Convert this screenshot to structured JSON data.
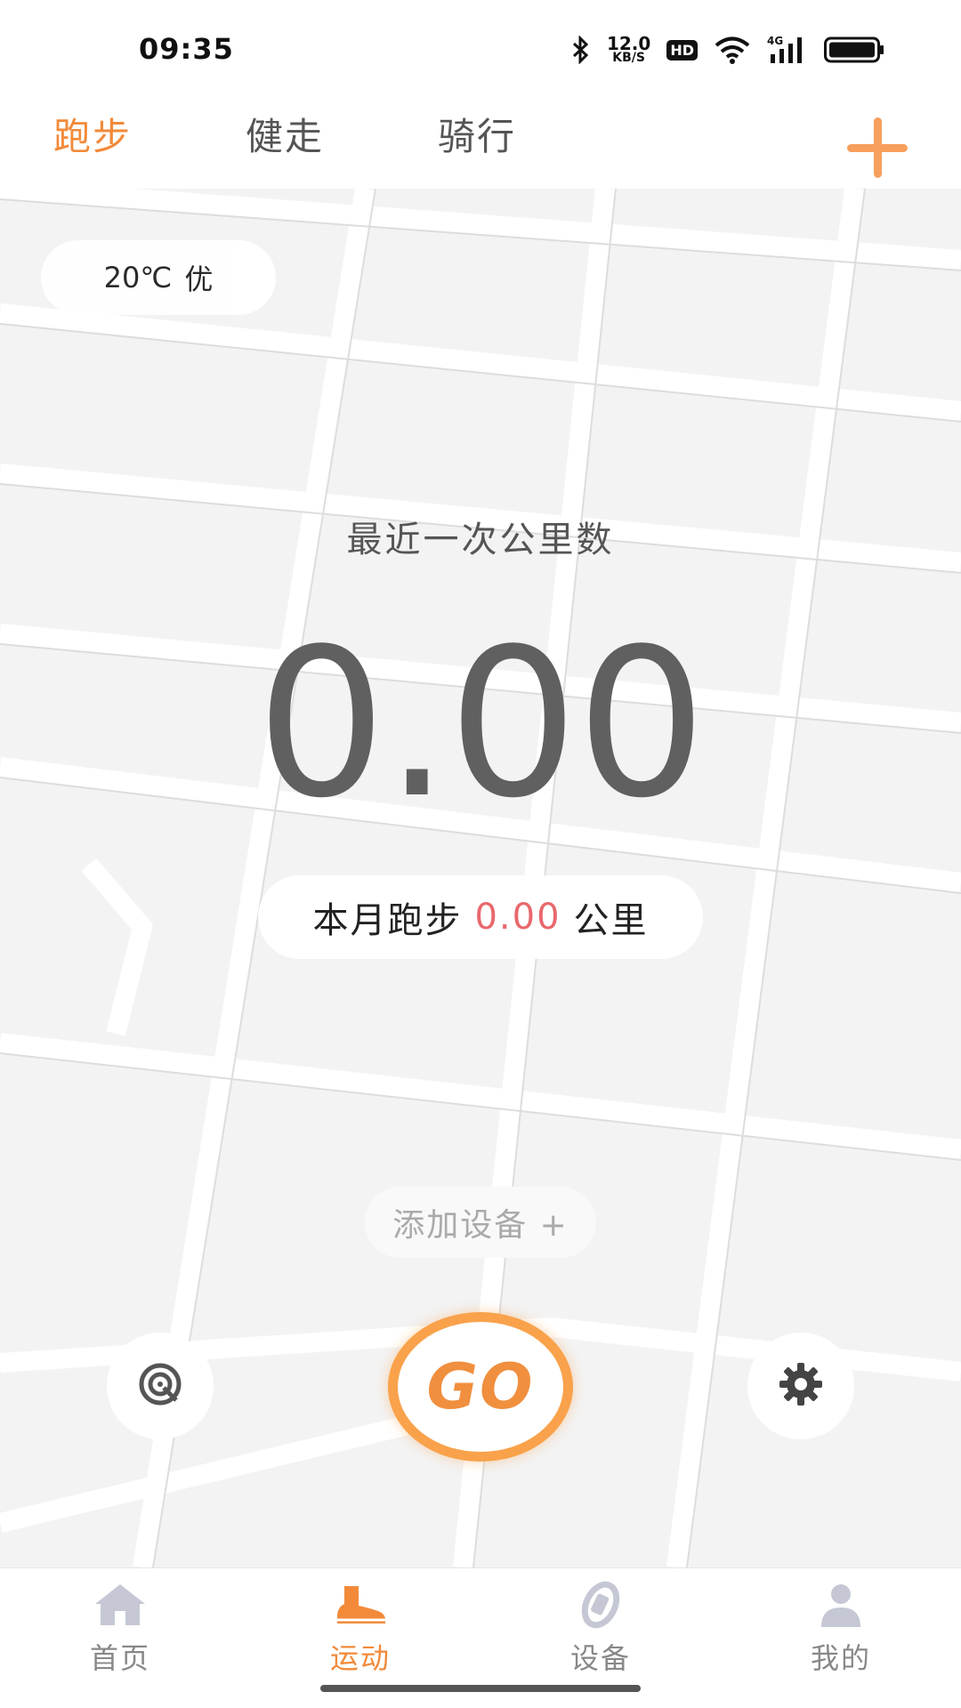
{
  "status": {
    "time": "09:35",
    "speed_value": "12.0",
    "speed_unit": "KB/S",
    "hd": "HD",
    "network": "4G",
    "icons": [
      "bluetooth-icon",
      "wifi-icon",
      "signal-icon",
      "battery-icon"
    ]
  },
  "tabs": {
    "items": [
      {
        "label": "跑步",
        "active": true
      },
      {
        "label": "健走",
        "active": false
      },
      {
        "label": "骑行",
        "active": false
      }
    ],
    "add_icon": "plus-icon"
  },
  "main": {
    "weather": "20℃",
    "air_quality": "优",
    "recent_label": "最近一次公里数",
    "recent_value": "0.00",
    "month_prefix": "本月跑步",
    "month_value": "0.00",
    "month_unit": "公里",
    "add_device": "添加设备 +",
    "go_label": "GO",
    "left_icon": "target-icon",
    "right_icon": "gear-icon"
  },
  "nav": {
    "items": [
      {
        "label": "首页",
        "icon": "home-icon",
        "active": false
      },
      {
        "label": "运动",
        "icon": "shoe-icon",
        "active": true
      },
      {
        "label": "设备",
        "icon": "band-icon",
        "active": false
      },
      {
        "label": "我的",
        "icon": "user-icon",
        "active": false
      }
    ]
  },
  "colors": {
    "accent": "#f28a3a",
    "value_red": "#e8686c",
    "go_ring": "#f9a24b"
  }
}
